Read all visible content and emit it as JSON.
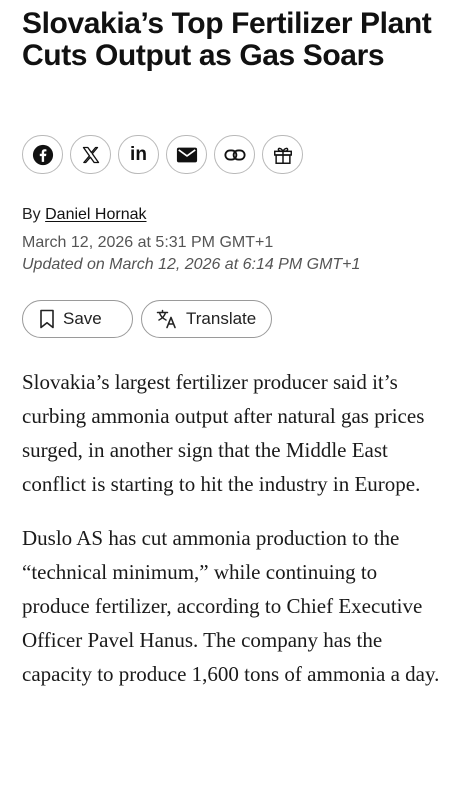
{
  "article": {
    "headline": "Slovakia’s Top Fertilizer Plant Cuts Output as Gas Soars",
    "byline_prefix": "By ",
    "author": "Daniel Hornak",
    "published": "March 12, 2026 at 5:31 PM GMT+1",
    "updated": "Updated on March 12, 2026 at 6:14 PM GMT+1",
    "paragraphs": [
      "Slovakia’s largest fertilizer producer said it’s curbing ammonia output after natural gas prices surged, in another sign that the Middle East conflict is starting to hit the industry in Europe.",
      "Duslo AS has cut ammonia production to the “technical minimum,” while continuing to produce fertilizer, according to Chief Executive Officer Pavel Hanus. The company has the capacity to produce 1,600 tons of ammonia a day."
    ]
  },
  "share": {
    "icons": [
      "facebook-icon",
      "x-icon",
      "linkedin-icon",
      "mail-icon",
      "link-icon",
      "gift-icon"
    ],
    "linkedin_text": "in"
  },
  "actions": {
    "save_label": "Save",
    "translate_label": "Translate"
  },
  "colors": {
    "text": "#111111",
    "muted": "#555555",
    "border": "#b9b9b9"
  }
}
